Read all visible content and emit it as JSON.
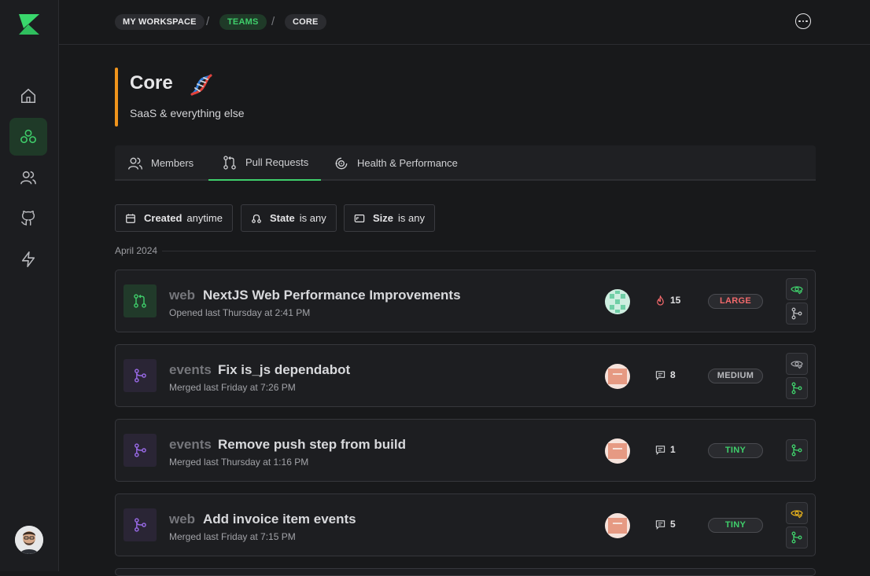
{
  "breadcrumb": {
    "items": [
      "MY WORKSPACE",
      "TEAMS",
      "CORE"
    ],
    "separator": "/"
  },
  "team": {
    "name": "Core",
    "emoji_icon": "dna-icon",
    "description": "SaaS & everything else",
    "accent_color": "#f0941c"
  },
  "tabs": [
    {
      "label": "Members",
      "icon": "members-icon"
    },
    {
      "label": "Pull Requests",
      "icon": "pull-request-icon",
      "active": true
    },
    {
      "label": "Health & Performance",
      "icon": "gauge-icon"
    }
  ],
  "filters": [
    {
      "key": "Created",
      "value": "anytime",
      "icon": "calendar-icon"
    },
    {
      "key": "State",
      "value": "is any",
      "icon": "state-icon"
    },
    {
      "key": "Size",
      "value": "is any",
      "icon": "size-icon"
    }
  ],
  "group_label": "April 2024",
  "pull_requests": [
    {
      "repo": "web",
      "title": "NextJS Web Performance Improvements",
      "meta": "Opened last Thursday at 2:41 PM",
      "state": "open",
      "stat_icon": "flame-icon",
      "stat_value": "15",
      "size": "LARGE",
      "size_color": "#f2696b"
    },
    {
      "repo": "events",
      "title": "Fix is_js dependabot",
      "meta": "Merged last Friday at 7:26 PM",
      "state": "merged",
      "stat_icon": "comment-icon",
      "stat_value": "8",
      "size": "MEDIUM",
      "size_color": "#b9babe"
    },
    {
      "repo": "events",
      "title": "Remove push step from build",
      "meta": "Merged last Thursday at 1:16 PM",
      "state": "merged",
      "stat_icon": "comment-icon",
      "stat_value": "1",
      "size": "TINY",
      "size_color": "#3fcf6b"
    },
    {
      "repo": "web",
      "title": "Add invoice item events",
      "meta": "Merged last Friday at 7:15 PM",
      "state": "merged",
      "stat_icon": "comment-icon",
      "stat_value": "5",
      "size": "TINY",
      "size_color": "#3fcf6b"
    }
  ],
  "colors": {
    "brand": "#3fcf6b",
    "open": "#3fcf6b",
    "merged": "#9b6bea",
    "review_ok": "#3fcf6b",
    "review_pending": "#e8b21c"
  }
}
